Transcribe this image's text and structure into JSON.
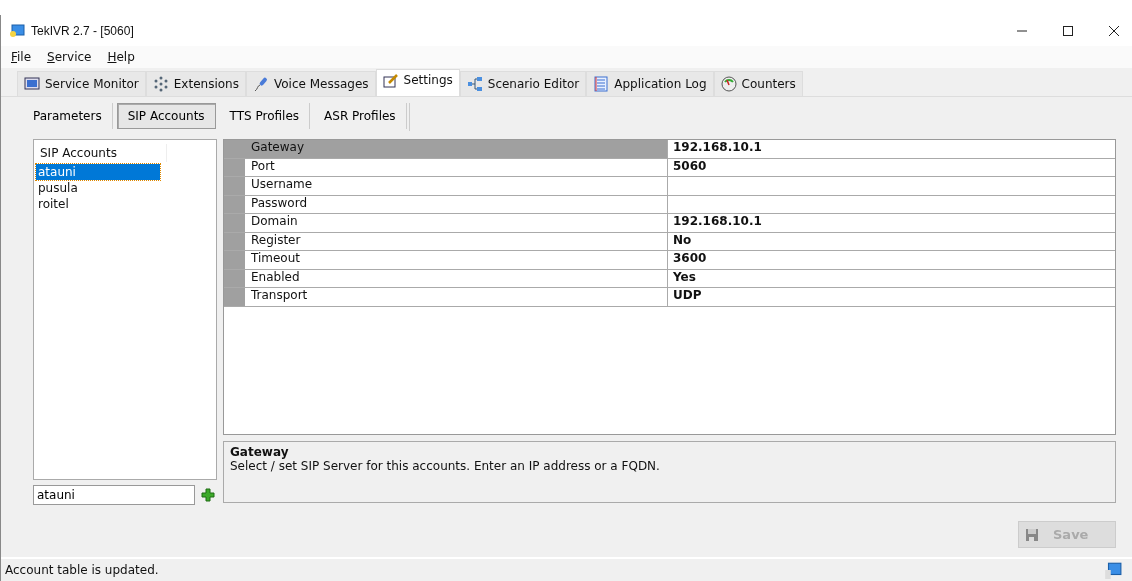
{
  "window": {
    "title": "TekIVR 2.7 - [5060]"
  },
  "menu": [
    "File",
    "Service",
    "Help"
  ],
  "tabs": [
    {
      "label": "Service Monitor",
      "selected": false
    },
    {
      "label": "Extensions",
      "selected": false
    },
    {
      "label": "Voice Messages",
      "selected": false
    },
    {
      "label": "Settings",
      "selected": true
    },
    {
      "label": "Scenario Editor",
      "selected": false
    },
    {
      "label": "Application Log",
      "selected": false
    },
    {
      "label": "Counters",
      "selected": false
    }
  ],
  "subtabs": [
    {
      "label": "Parameters",
      "selected": false
    },
    {
      "label": "SIP Accounts",
      "selected": true
    },
    {
      "label": "TTS Profiles",
      "selected": false
    },
    {
      "label": "ASR Profiles",
      "selected": false
    }
  ],
  "accounts": {
    "header": "SIP Accounts",
    "items": [
      {
        "label": "atauni",
        "selected": true
      },
      {
        "label": "pusula",
        "selected": false
      },
      {
        "label": "roitel",
        "selected": false
      }
    ],
    "new_name": "atauni"
  },
  "properties": [
    {
      "name": "Gateway",
      "value": "192.168.10.1",
      "selected": true
    },
    {
      "name": "Port",
      "value": "5060",
      "selected": false
    },
    {
      "name": "Username",
      "selected": false
    },
    {
      "name": "Password",
      "selected": false
    },
    {
      "name": "Domain",
      "value": "192.168.10.1",
      "selected": false
    },
    {
      "name": "Register",
      "value": "No",
      "selected": false
    },
    {
      "name": "Timeout",
      "value": "3600",
      "selected": false
    },
    {
      "name": "Enabled",
      "value": "Yes",
      "selected": false
    },
    {
      "name": "Transport",
      "value": "UDP",
      "selected": false
    }
  ],
  "description": {
    "title": "Gateway",
    "text": "Select / set SIP Server for this accounts. Enter an IP address or a FQDN."
  },
  "save_button": {
    "label": "Save",
    "disabled": true
  },
  "status_bar": "Account table is updated."
}
